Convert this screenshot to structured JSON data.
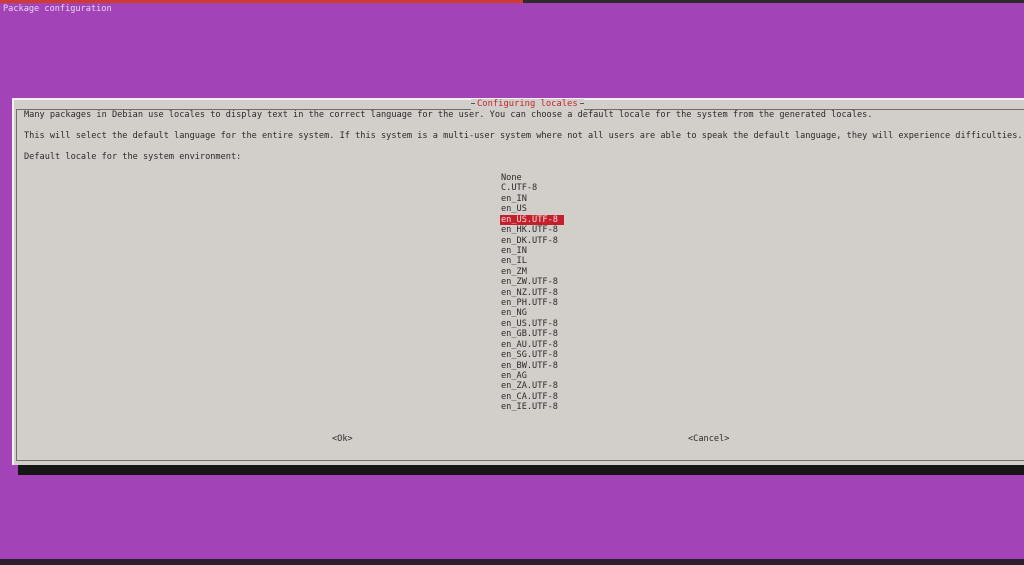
{
  "backtitle": "Package configuration",
  "dialog": {
    "title": "Configuring locales",
    "line1": "Many packages in Debian use locales to display text in the correct language for the user. You can choose a default locale for the system from the generated locales.",
    "line2": "This will select the default language for the entire system. If this system is a multi-user system where not all users are able to speak the default language, they will experience difficulties.",
    "prompt": "Default locale for the system environment:",
    "selected_locale": "en_US.UTF-8",
    "locales": [
      "None",
      "C.UTF-8",
      "en_IN",
      "en_US",
      "en_US.UTF-8",
      "en_HK.UTF-8",
      "en_DK.UTF-8",
      "en_IN",
      "en_IL",
      "en_ZM",
      "en_ZW.UTF-8",
      "en_NZ.UTF-8",
      "en_PH.UTF-8",
      "en_NG",
      "en_US.UTF-8",
      "en_GB.UTF-8",
      "en_AU.UTF-8",
      "en_SG.UTF-8",
      "en_BW.UTF-8",
      "en_AG",
      "en_ZA.UTF-8",
      "en_CA.UTF-8",
      "en_IE.UTF-8"
    ],
    "ok_label": "<Ok>",
    "cancel_label": "<Cancel>"
  },
  "colors": {
    "background": "#a243b8",
    "dialog": "#d2cfcb",
    "accent": "#c4202c"
  }
}
